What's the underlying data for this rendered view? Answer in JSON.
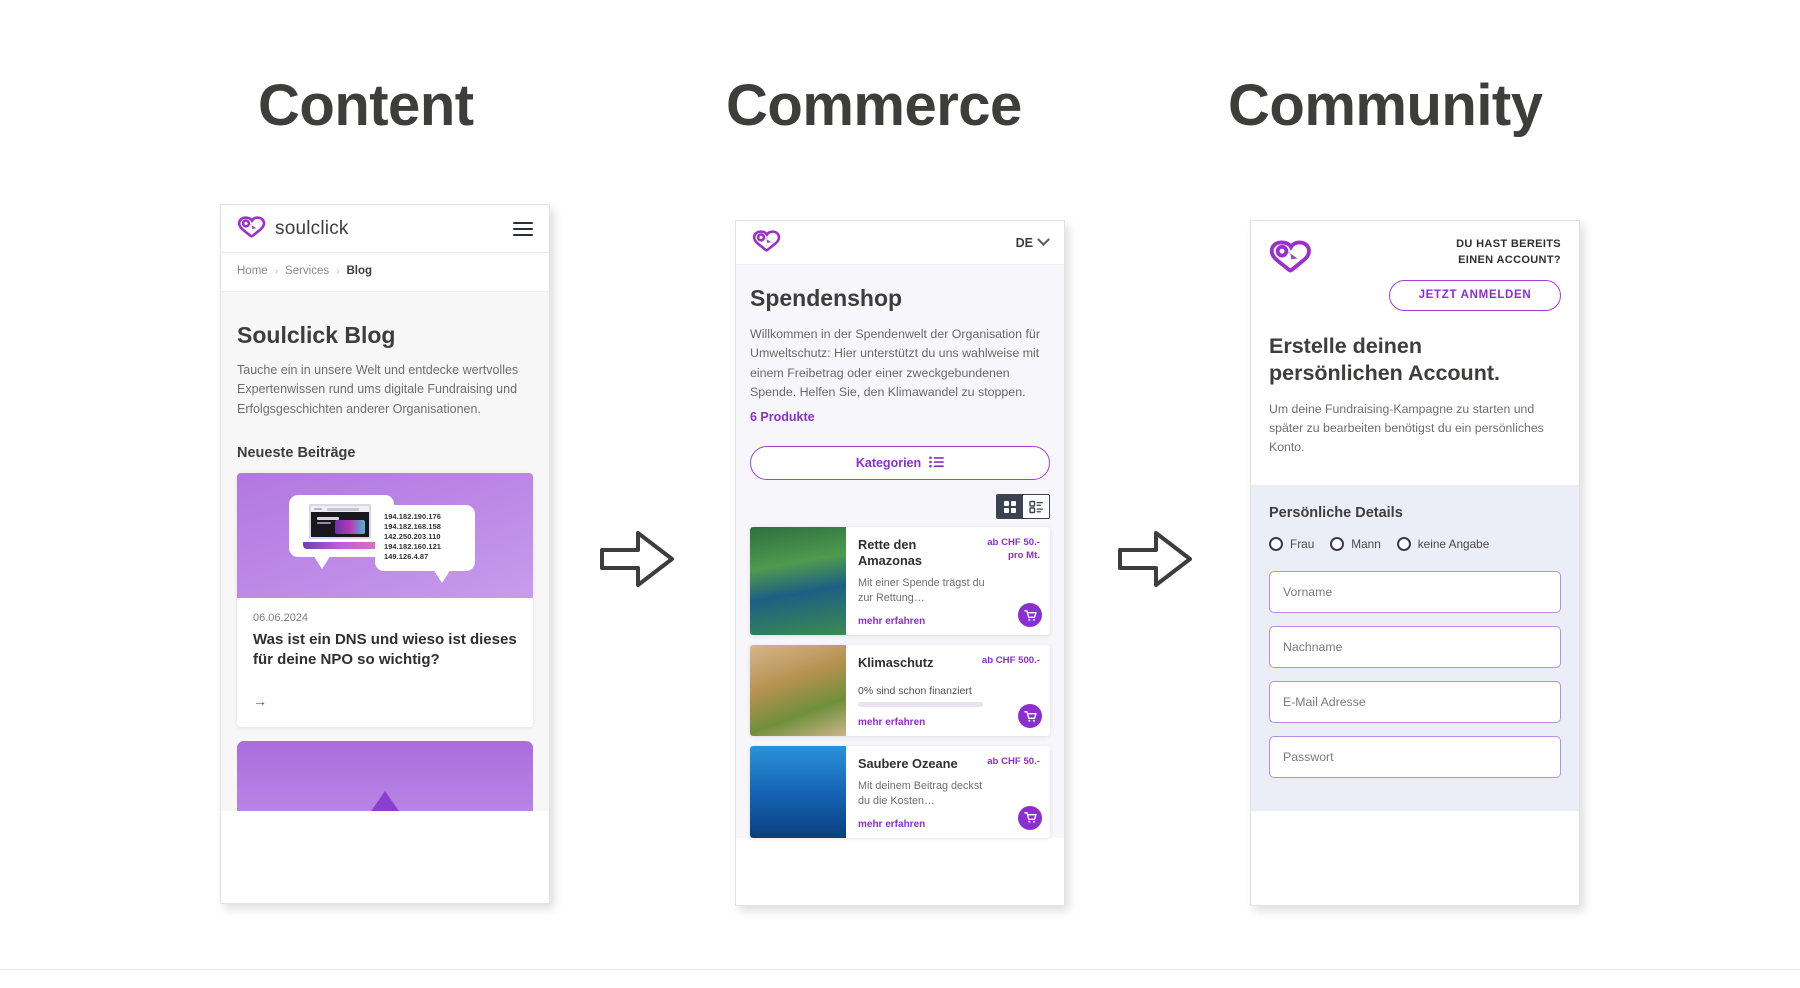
{
  "sections": [
    {
      "title": "Content"
    },
    {
      "title": "Commerce"
    },
    {
      "title": "Community"
    }
  ],
  "colors": {
    "purple": "#8b2fd0",
    "purple_border": "#9c43d6",
    "dark_text": "#3d3d3c",
    "muted_text": "#6e6e6e",
    "form_bg": "#eceef7"
  },
  "phone_content": {
    "brand": "soulclick",
    "menu_icon": "hamburger-icon",
    "breadcrumb": {
      "items": [
        "Home",
        "Services",
        "Blog"
      ],
      "separator": "›"
    },
    "page_title": "Soulclick Blog",
    "lead": "Tauche ein in unsere Welt und entdecke wertvolles Expertenwissen rund ums digitale Fundraising und Erfolgsgeschichten anderer Organisationen.",
    "subhead": "Neueste Beiträge",
    "post": {
      "date": "06.06.2024",
      "title": "Was ist ein DNS und wieso ist dieses für deine NPO so wichtig?",
      "link_icon": "arrow-right-icon",
      "hero_ips": [
        "194.182.190.176",
        "194.182.168.158",
        "142.250.203.110",
        "194.182.160.121",
        "149.126.4.87"
      ]
    }
  },
  "phone_commerce": {
    "logo_icon": "soulclick-heart-logo",
    "language": "DE",
    "language_icon": "chevron-down-icon",
    "page_title": "Spendenshop",
    "lead": "Willkommen in der Spendenwelt der Organisation für Umweltschutz: Hier unterstützt du uns wahlweise mit einem Freibetrag oder einer zweckgebundenen Spende. Helfen Sie, den Klimawandel zu stoppen.",
    "product_count": "6 Produkte",
    "categories_button": "Kategorien",
    "categories_icon": "list-icon",
    "view_toggle": {
      "grid_icon": "grid-view-icon",
      "list_icon": "list-view-icon",
      "active": "grid"
    },
    "products": [
      {
        "name": "Rette den Amazonas",
        "price": "ab CHF 50.-\npro Mt.",
        "price_line1": "ab CHF 50.-",
        "price_line2": "pro Mt.",
        "description": "Mit einer Spende trägst du zur Rettung…",
        "link": "mehr erfahren",
        "cart_icon": "shopping-cart-icon",
        "image": "amazon-river-aerial"
      },
      {
        "name": "Klimaschutz",
        "price_line1": "ab CHF 500.-",
        "price_line2": "",
        "progress_label": "0% sind schon finanziert",
        "progress_percent": 0,
        "link": "mehr erfahren",
        "cart_icon": "shopping-cart-icon",
        "image": "hands-holding-plant"
      },
      {
        "name": "Saubere Ozeane",
        "price_line1": "ab CHF 50.-",
        "price_line2": "",
        "description": "Mit deinem Beitrag deckst du die Kosten…",
        "link": "mehr erfahren",
        "cart_icon": "shopping-cart-icon",
        "image": "plastic-bag-underwater"
      }
    ]
  },
  "phone_community": {
    "logo_icon": "soulclick-heart-logo",
    "account_prompt_line1": "DU HAST BEREITS",
    "account_prompt_line2": "EINEN ACCOUNT?",
    "login_button": "JETZT ANMELDEN",
    "title": "Erstelle deinen persönlichen Account.",
    "lead": "Um deine Fundraising-Kampagne zu starten und später zu bearbeiten benötigst du ein persönliches Konto.",
    "form_heading": "Persönliche Details",
    "salutations": [
      "Frau",
      "Mann",
      "keine Angabe"
    ],
    "fields": [
      {
        "placeholder": "Vorname",
        "value": ""
      },
      {
        "placeholder": "Nachname",
        "value": ""
      },
      {
        "placeholder": "E-Mail Adresse",
        "value": ""
      },
      {
        "placeholder": "Passwort",
        "value": ""
      }
    ]
  }
}
